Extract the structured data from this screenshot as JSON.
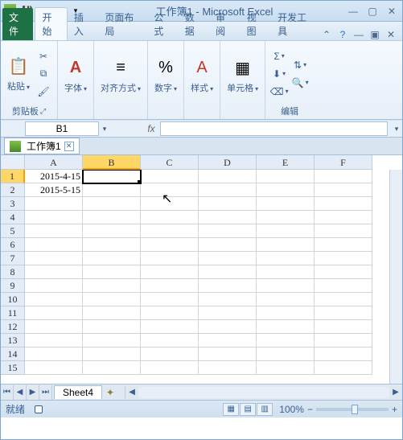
{
  "window": {
    "title": "工作簿1 - Microsoft Excel",
    "qat": {
      "save": "💾",
      "undo": "↶",
      "redo": "↷"
    }
  },
  "tabs": {
    "file": "文件",
    "items": [
      "开始",
      "插入",
      "页面布局",
      "公式",
      "数据",
      "审阅",
      "视图",
      "开发工具"
    ],
    "active_index": 0
  },
  "ribbon": {
    "clipboard": {
      "label": "剪贴板",
      "paste": "粘贴"
    },
    "font": {
      "label": "字体"
    },
    "align": {
      "label": "对齐方式"
    },
    "number": {
      "label": "数字"
    },
    "styles": {
      "label": "样式"
    },
    "cells": {
      "label": "单元格"
    },
    "editing": {
      "label": "编辑"
    }
  },
  "namebox": {
    "value": "B1",
    "fx": "fx"
  },
  "doctab": {
    "name": "工作簿1"
  },
  "grid": {
    "columns": [
      "A",
      "B",
      "C",
      "D",
      "E",
      "F"
    ],
    "selected_col": "B",
    "selected_row": 1,
    "row_count": 15,
    "data": {
      "A1": "2015-4-15",
      "A2": "2015-5-15"
    }
  },
  "sheets": {
    "active": "Sheet4"
  },
  "status": {
    "ready": "就绪",
    "zoom": "100%",
    "minus": "−",
    "plus": "+"
  }
}
